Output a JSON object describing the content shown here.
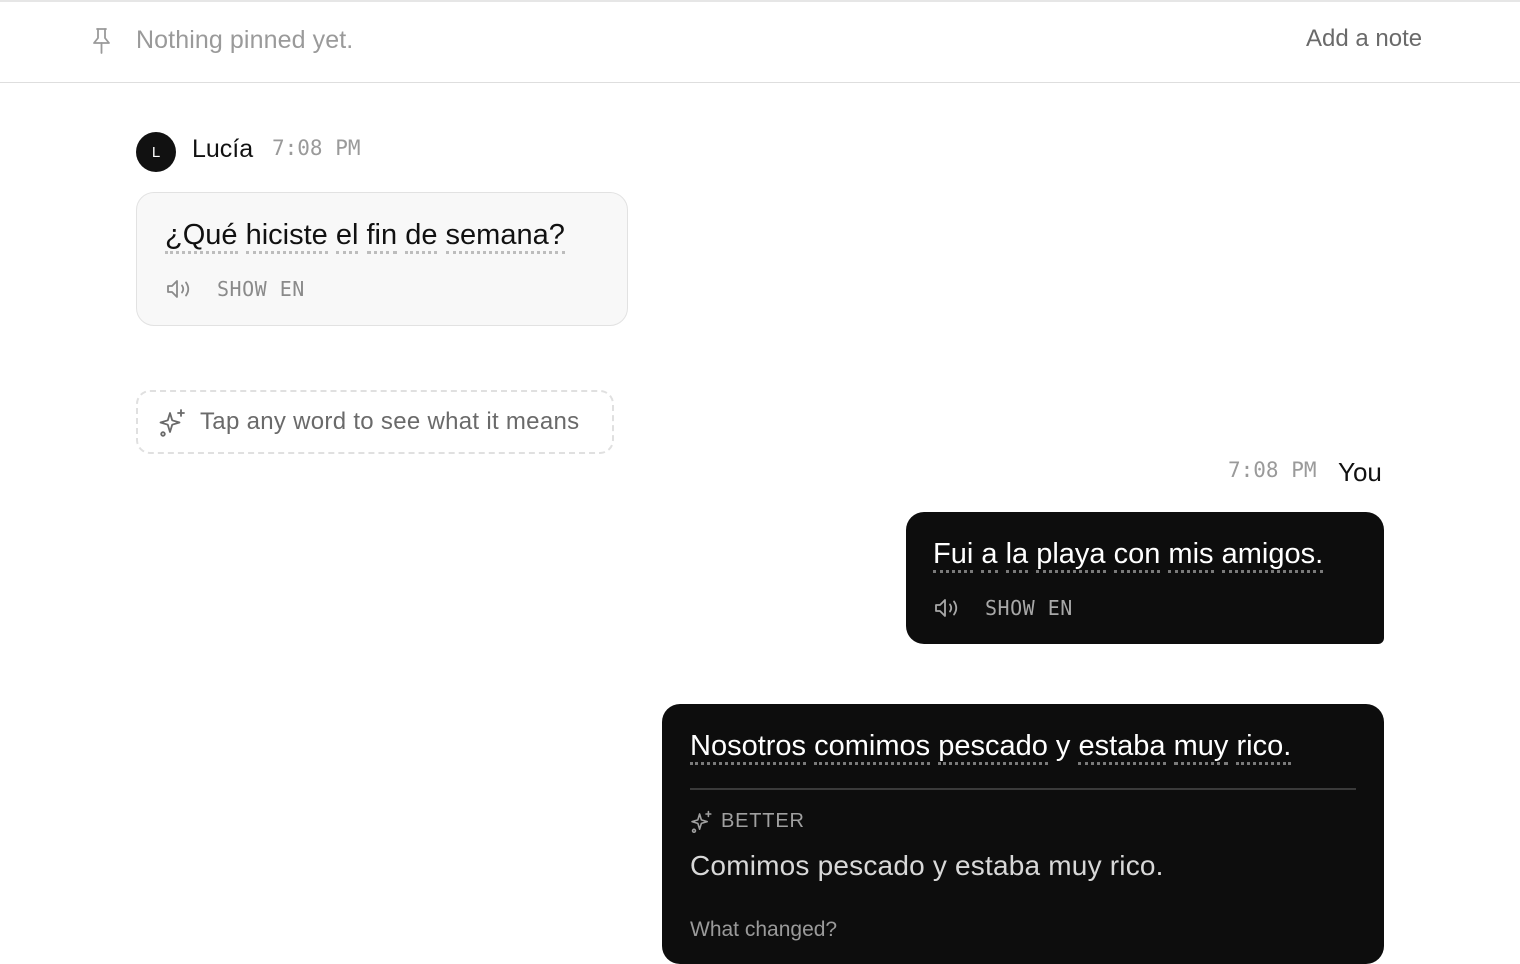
{
  "pinbar": {
    "empty_text": "Nothing pinned yet.",
    "add_note_label": "Add a note",
    "icon": "pin-icon"
  },
  "messages": [
    {
      "sender": "Lucía",
      "avatar_initial": "L",
      "time": "7:08 PM",
      "words": [
        "¿Qué",
        "hiciste",
        "el",
        "fin",
        "de",
        "semana?"
      ],
      "show_translation_label": "SHOW EN",
      "speaker_icon": "speaker-icon"
    },
    {
      "sender": "You",
      "time": "7:08 PM",
      "words": [
        "Fui",
        "a",
        "la",
        "playa",
        "con",
        "mis",
        "amigos."
      ],
      "show_translation_label": "SHOW EN",
      "speaker_icon": "speaker-icon"
    },
    {
      "sender": "You",
      "words": [
        "Nosotros",
        "comimos",
        "pescado",
        "y",
        "estaba",
        "muy",
        "rico."
      ],
      "correction": {
        "label": "BETTER",
        "icon": "sparkle-icon",
        "text": "Comimos pescado y estaba muy rico.",
        "what_changed_label": "What changed?"
      }
    }
  ],
  "hint": {
    "text": "Tap any word to see what it means",
    "icon": "sparkle-icon"
  },
  "colors": {
    "outgoing_bubble": "#0d0d0d",
    "incoming_bubble": "#f8f8f8",
    "muted_text": "#9a9a9a"
  }
}
